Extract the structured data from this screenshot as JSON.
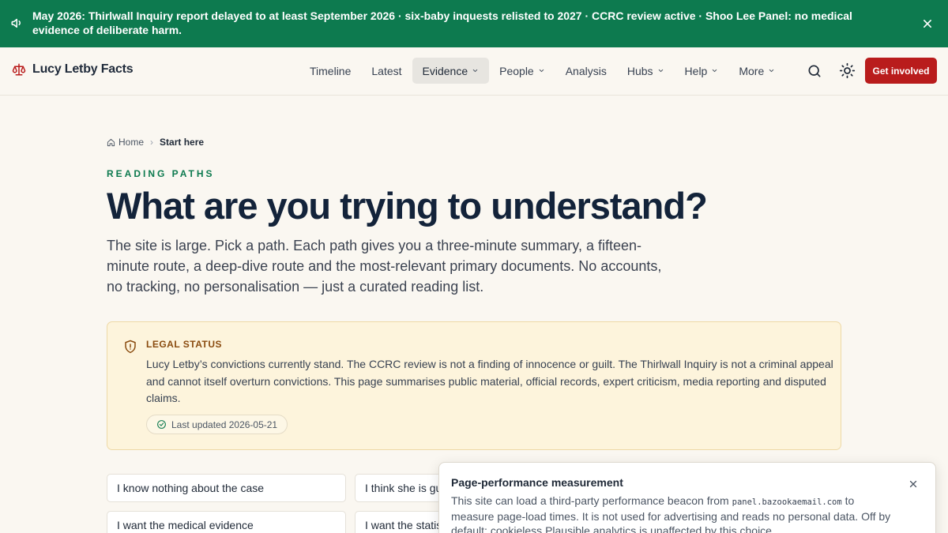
{
  "banner": {
    "label": "May 2026:",
    "text_a": " Thirlwall Inquiry report delayed to at least September 2026 · six-baby inquests relisted to 2027 · CCRC review active · Shoo Lee Panel: ",
    "text_b": "no medical evidence of deliberate harm.",
    "icon": "megaphone-icon",
    "close_icon": "close-icon"
  },
  "header": {
    "brand": "Lucy Letby Facts",
    "brand_icon": "scales-icon",
    "nav": [
      {
        "label": "Timeline",
        "dropdown": false,
        "active": false
      },
      {
        "label": "Latest",
        "dropdown": false,
        "active": false
      },
      {
        "label": "Evidence",
        "dropdown": true,
        "active": true
      },
      {
        "label": "People",
        "dropdown": true,
        "active": false
      },
      {
        "label": "Analysis",
        "dropdown": false,
        "active": false
      },
      {
        "label": "Hubs",
        "dropdown": true,
        "active": false
      },
      {
        "label": "Help",
        "dropdown": true,
        "active": false
      },
      {
        "label": "More",
        "dropdown": true,
        "active": false
      }
    ],
    "cta": "Get involved"
  },
  "breadcrumb": {
    "home": "Home",
    "current": "Start here"
  },
  "main": {
    "eyebrow": "READING PATHS",
    "title": "What are you trying to understand?",
    "lead": "The site is large. Pick a path. Each path gives you a three-minute summary, a fifteen-minute route, a deep-dive route and the most-relevant primary documents. No accounts, no tracking, no personalisation — just a curated reading list."
  },
  "legal": {
    "title": "LEGAL STATUS",
    "body": "Lucy Letby’s convictions currently stand. The CCRC review is not a finding of innocence or guilt. The Thirlwall Inquiry is not a criminal appeal and cannot itself overturn convictions. This page summarises public material, official records, expert criticism, media reporting and disputed claims.",
    "updated": "Last updated 2026-05-21"
  },
  "paths": [
    "I know nothing about the case",
    "I think she is guilty",
    "I want the medical evidence",
    "I want the statistics"
  ],
  "consent": {
    "title": "Page-performance measurement",
    "body_a": "This site can load a third-party performance beacon from ",
    "domain": "panel.bazookaemail.com",
    "body_b": " to measure page-load times. It is not used for advertising and reads no personal data. Off by default; cookieless Plausible analytics is unaffected by this choice."
  },
  "colors": {
    "banner_bg": "#0d7a4f",
    "accent_red": "#b91c1c",
    "eyebrow_green": "#0d7a4f",
    "legal_bg": "#fdf4dc",
    "legal_title": "#8a4b0f"
  }
}
